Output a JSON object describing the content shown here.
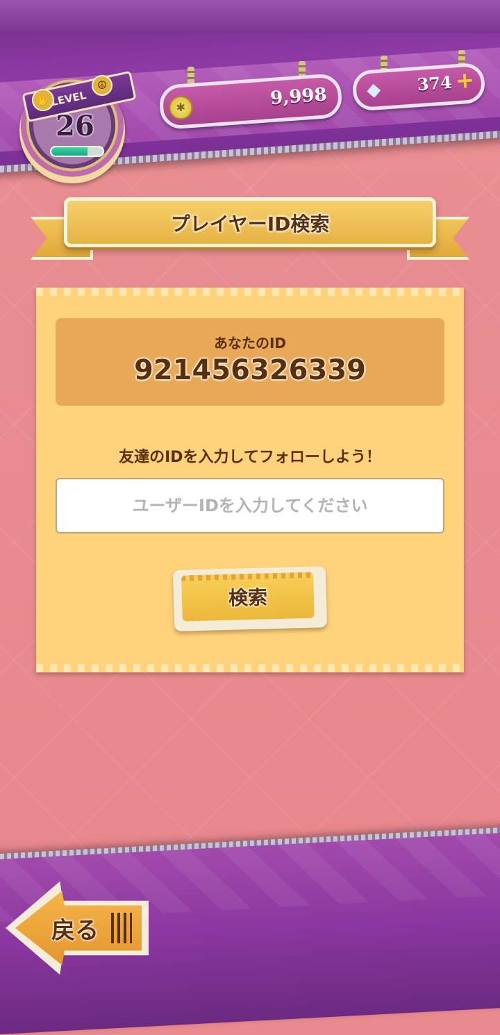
{
  "header": {
    "level_label": "LEVEL",
    "level": "26",
    "level_progress": 0.7,
    "coins": "9,998",
    "gems": "374",
    "gem_plus": "+"
  },
  "title": "プレイヤーID検索",
  "panel": {
    "my_id_label": "あなたのID",
    "my_id": "921456326339",
    "instruction": "友達のIDを入力してフォローしよう！",
    "input_placeholder": "ユーザーIDを入力してください",
    "input_value": "",
    "search_button": "検索"
  },
  "footer": {
    "back_button": "戻る"
  },
  "colors": {
    "background": "#e98a8e",
    "band_purple": "#8d3aa4",
    "panel": "#ffd27b",
    "ribbon_gold": "#f6d06a",
    "text_brown": "#5a2f0c"
  },
  "icons": [
    "hand-icon",
    "peace-icon",
    "coin-icon",
    "gem-icon",
    "plus-icon",
    "back-arrow-icon"
  ]
}
